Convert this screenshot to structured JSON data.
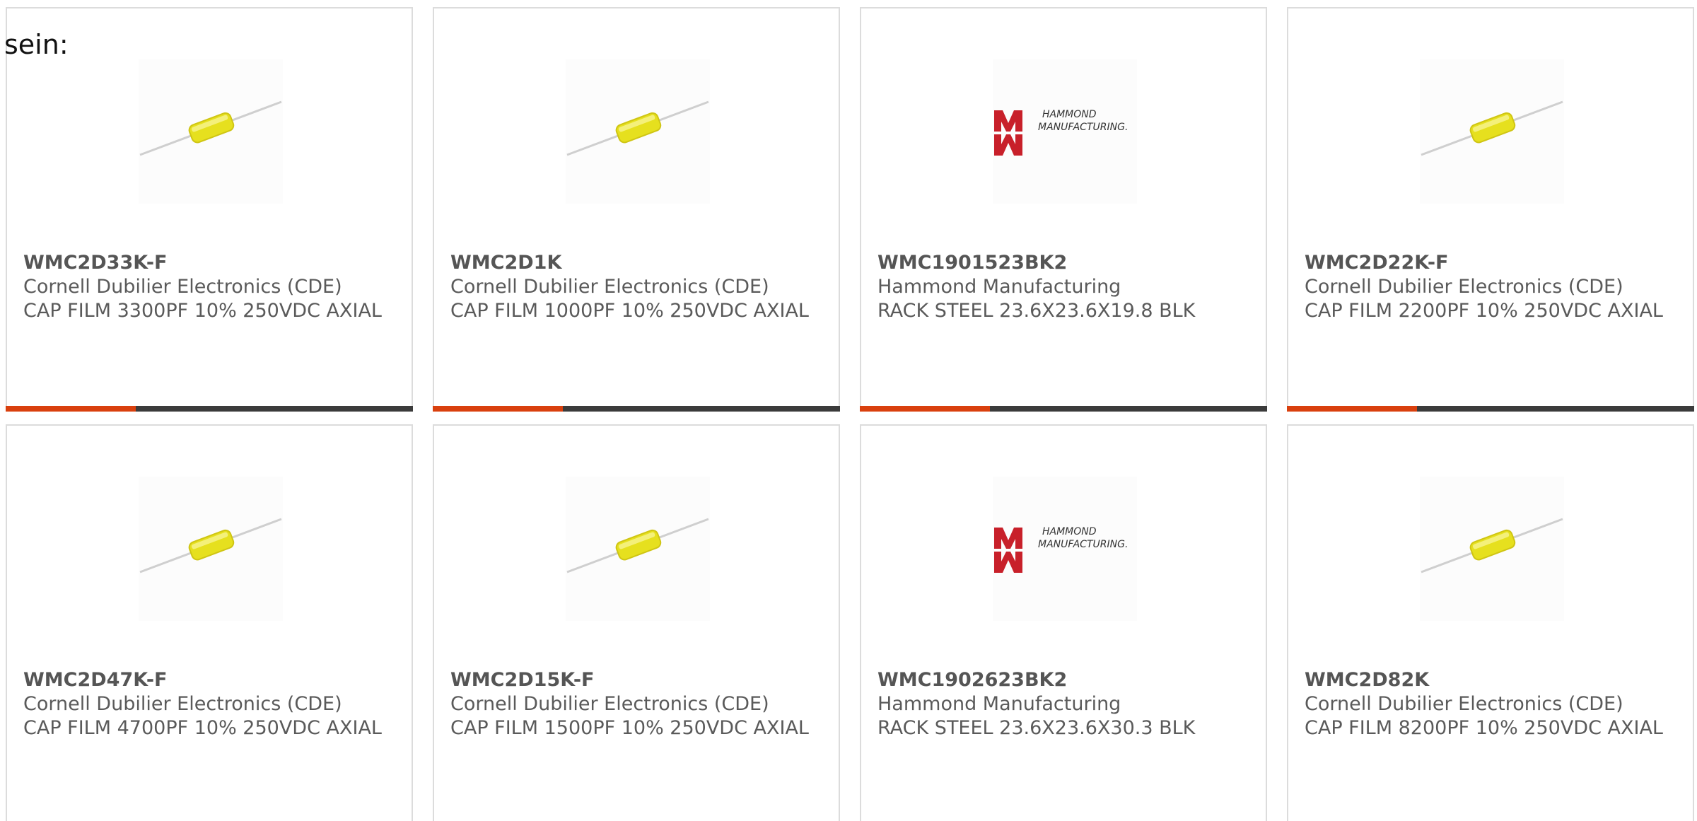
{
  "intro": {
    "text": "sein:"
  },
  "colors": {
    "accent_bar": "#d9400e",
    "dark_bar": "#3b3b3b",
    "card_border": "#dcdcdc",
    "capacitor_yellow": "#e6e01e",
    "hammond_red": "#c8202a"
  },
  "products": [
    {
      "part_number": "WMC2D33K-F",
      "manufacturer": "Cornell Dubilier Electronics (CDE)",
      "description": "CAP FILM 3300PF 10% 250VDC AXIAL",
      "image": "axial-capacitor-image"
    },
    {
      "part_number": "WMC2D1K",
      "manufacturer": "Cornell Dubilier Electronics (CDE)",
      "description": "CAP FILM 1000PF 10% 250VDC AXIAL",
      "image": "axial-capacitor-image"
    },
    {
      "part_number": "WMC1901523BK2",
      "manufacturer": "Hammond Manufacturing",
      "description": "RACK STEEL 23.6X23.6X19.8 BLK",
      "image": "hammond-logo-image",
      "logo_text_1": "HAMMOND",
      "logo_text_2": "MANUFACTURING."
    },
    {
      "part_number": "WMC2D22K-F",
      "manufacturer": "Cornell Dubilier Electronics (CDE)",
      "description": "CAP FILM 2200PF 10% 250VDC AXIAL",
      "image": "axial-capacitor-image"
    },
    {
      "part_number": "WMC2D47K-F",
      "manufacturer": "Cornell Dubilier Electronics (CDE)",
      "description": "CAP FILM 4700PF 10% 250VDC AXIAL",
      "image": "axial-capacitor-image"
    },
    {
      "part_number": "WMC2D15K-F",
      "manufacturer": "Cornell Dubilier Electronics (CDE)",
      "description": "CAP FILM 1500PF 10% 250VDC AXIAL",
      "image": "axial-capacitor-image"
    },
    {
      "part_number": "WMC1902623BK2",
      "manufacturer": "Hammond Manufacturing",
      "description": "RACK STEEL 23.6X23.6X30.3 BLK",
      "image": "hammond-logo-image",
      "logo_text_1": "HAMMOND",
      "logo_text_2": "MANUFACTURING."
    },
    {
      "part_number": "WMC2D82K",
      "manufacturer": "Cornell Dubilier Electronics (CDE)",
      "description": "CAP FILM 8200PF 10% 250VDC AXIAL",
      "image": "axial-capacitor-image"
    }
  ]
}
